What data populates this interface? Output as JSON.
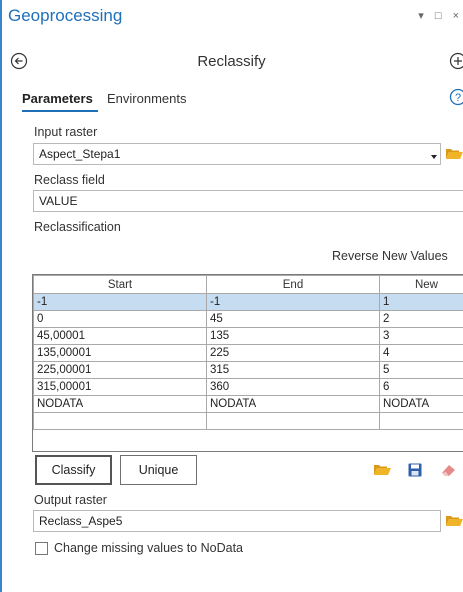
{
  "pane": {
    "title": "Geoprocessing",
    "controls": "▾ □ ×"
  },
  "tool": {
    "title": "Reclassify"
  },
  "tabs": {
    "parameters": "Parameters",
    "environments": "Environments"
  },
  "input_raster": {
    "label": "Input raster",
    "value": "Aspect_Stepa1"
  },
  "reclass_field": {
    "label": "Reclass field",
    "value": "VALUE"
  },
  "reclassification": {
    "label": "Reclassification",
    "reverse_label": "Reverse New Values",
    "columns": [
      "Start",
      "End",
      "New"
    ],
    "rows": [
      [
        "-1",
        "-1",
        "1"
      ],
      [
        "0",
        "45",
        "2"
      ],
      [
        "45,00001",
        "135",
        "3"
      ],
      [
        "135,00001",
        "225",
        "4"
      ],
      [
        "225,00001",
        "315",
        "5"
      ],
      [
        "315,00001",
        "360",
        "6"
      ],
      [
        "NODATA",
        "NODATA",
        "NODATA"
      ],
      [
        "",
        "",
        ""
      ]
    ],
    "selected_row": 0
  },
  "buttons": {
    "classify": "Classify",
    "unique": "Unique"
  },
  "output_raster": {
    "label": "Output raster",
    "value": "Reclass_Aspe5"
  },
  "missing_values": {
    "label": "Change missing values to NoData",
    "checked": false
  },
  "colors": {
    "accent": "#1f6fb8",
    "selected_row": "#c6dcf1",
    "folder": "#f0b428",
    "save": "#2f5fa8",
    "eraser": "#e58a8a"
  }
}
